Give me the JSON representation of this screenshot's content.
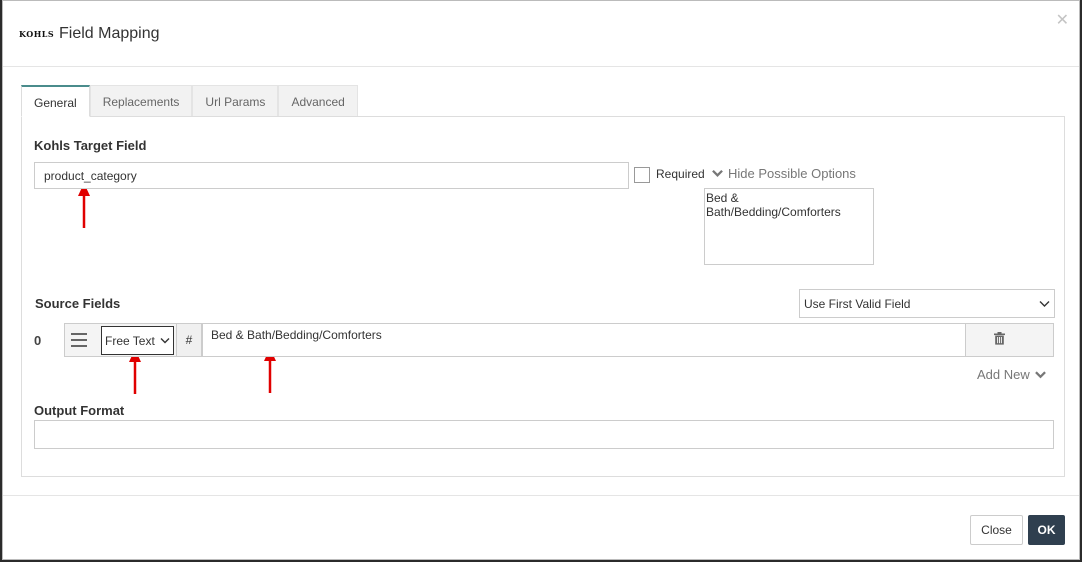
{
  "header": {
    "logo_text": "KOHLS",
    "title": "Field Mapping"
  },
  "tabs": [
    {
      "label": "General",
      "active": true
    },
    {
      "label": "Replacements",
      "active": false
    },
    {
      "label": "Url Params",
      "active": false
    },
    {
      "label": "Advanced",
      "active": false
    }
  ],
  "target": {
    "label": "Kohls Target Field",
    "value": "product_category",
    "required_label": "Required",
    "required_checked": false,
    "hide_options_label": "Hide Possible Options",
    "options": [
      "Bed & Bath/Bedding/Comforters"
    ]
  },
  "source": {
    "label": "Source Fields",
    "strategy": "Use First Valid Field",
    "rows": [
      {
        "index": "0",
        "type": "Free Text",
        "hash": "#",
        "value": "Bed & Bath/Bedding/Comforters"
      }
    ],
    "add_new_label": "Add New"
  },
  "output": {
    "label": "Output Format",
    "value": ""
  },
  "footer": {
    "close_label": "Close",
    "ok_label": "OK"
  },
  "colors": {
    "accent_tab": "#4a8c8c",
    "ok_button": "#2f3f4f",
    "annotation_arrow": "#e00000"
  },
  "icons": {
    "close": "close-icon",
    "chevron": "chevron-down-icon",
    "handle": "drag-handle-icon",
    "trash": "trash-icon"
  }
}
